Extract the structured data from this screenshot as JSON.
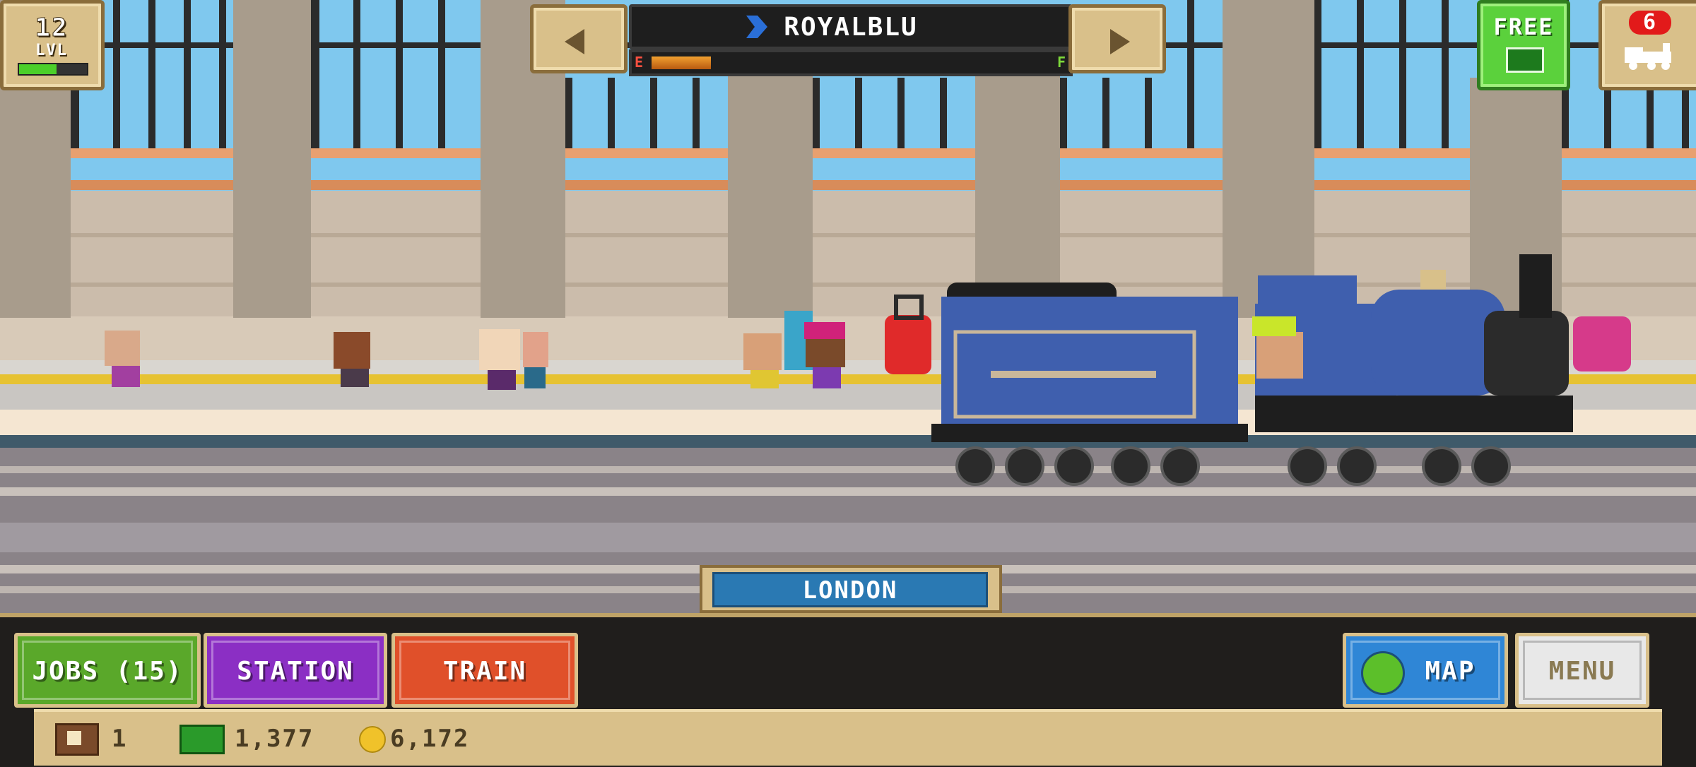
{
  "hud": {
    "level_number": "12",
    "level_label": "LVL",
    "level_progress": 0.55,
    "train_name": "ROYALBLU",
    "fuel_empty_label": "E",
    "fuel_full_label": "F",
    "fuel_level": 0.15,
    "free_label": "FREE",
    "trains_count": "6"
  },
  "station": {
    "name": "LONDON"
  },
  "actions": {
    "jobs_label": "JOBS (15)",
    "station_label": "STATION",
    "train_label": "TRAIN",
    "map_label": "MAP",
    "menu_label": "MENU"
  },
  "currency": {
    "tickets": "1",
    "cash": "1,377",
    "coins": "6,172"
  },
  "colors": {
    "jobs_button": "#5aa82a",
    "station_button": "#8b2fc4",
    "train_button": "#e0502a",
    "map_button": "#2f86d6",
    "menu_button": "#e8e8e8",
    "free_button": "#5bd13c",
    "train_body": "#3f5fae"
  },
  "icons": {
    "prev_train": "arrow-left-icon",
    "next_train": "arrow-right-icon",
    "flag": "blue-flag-icon",
    "free_gift": "cash-gift-icon",
    "trains": "locomotive-icon",
    "map": "globe-icon",
    "ticket": "ticket-icon",
    "cash": "cash-icon",
    "coin": "coin-icon"
  }
}
